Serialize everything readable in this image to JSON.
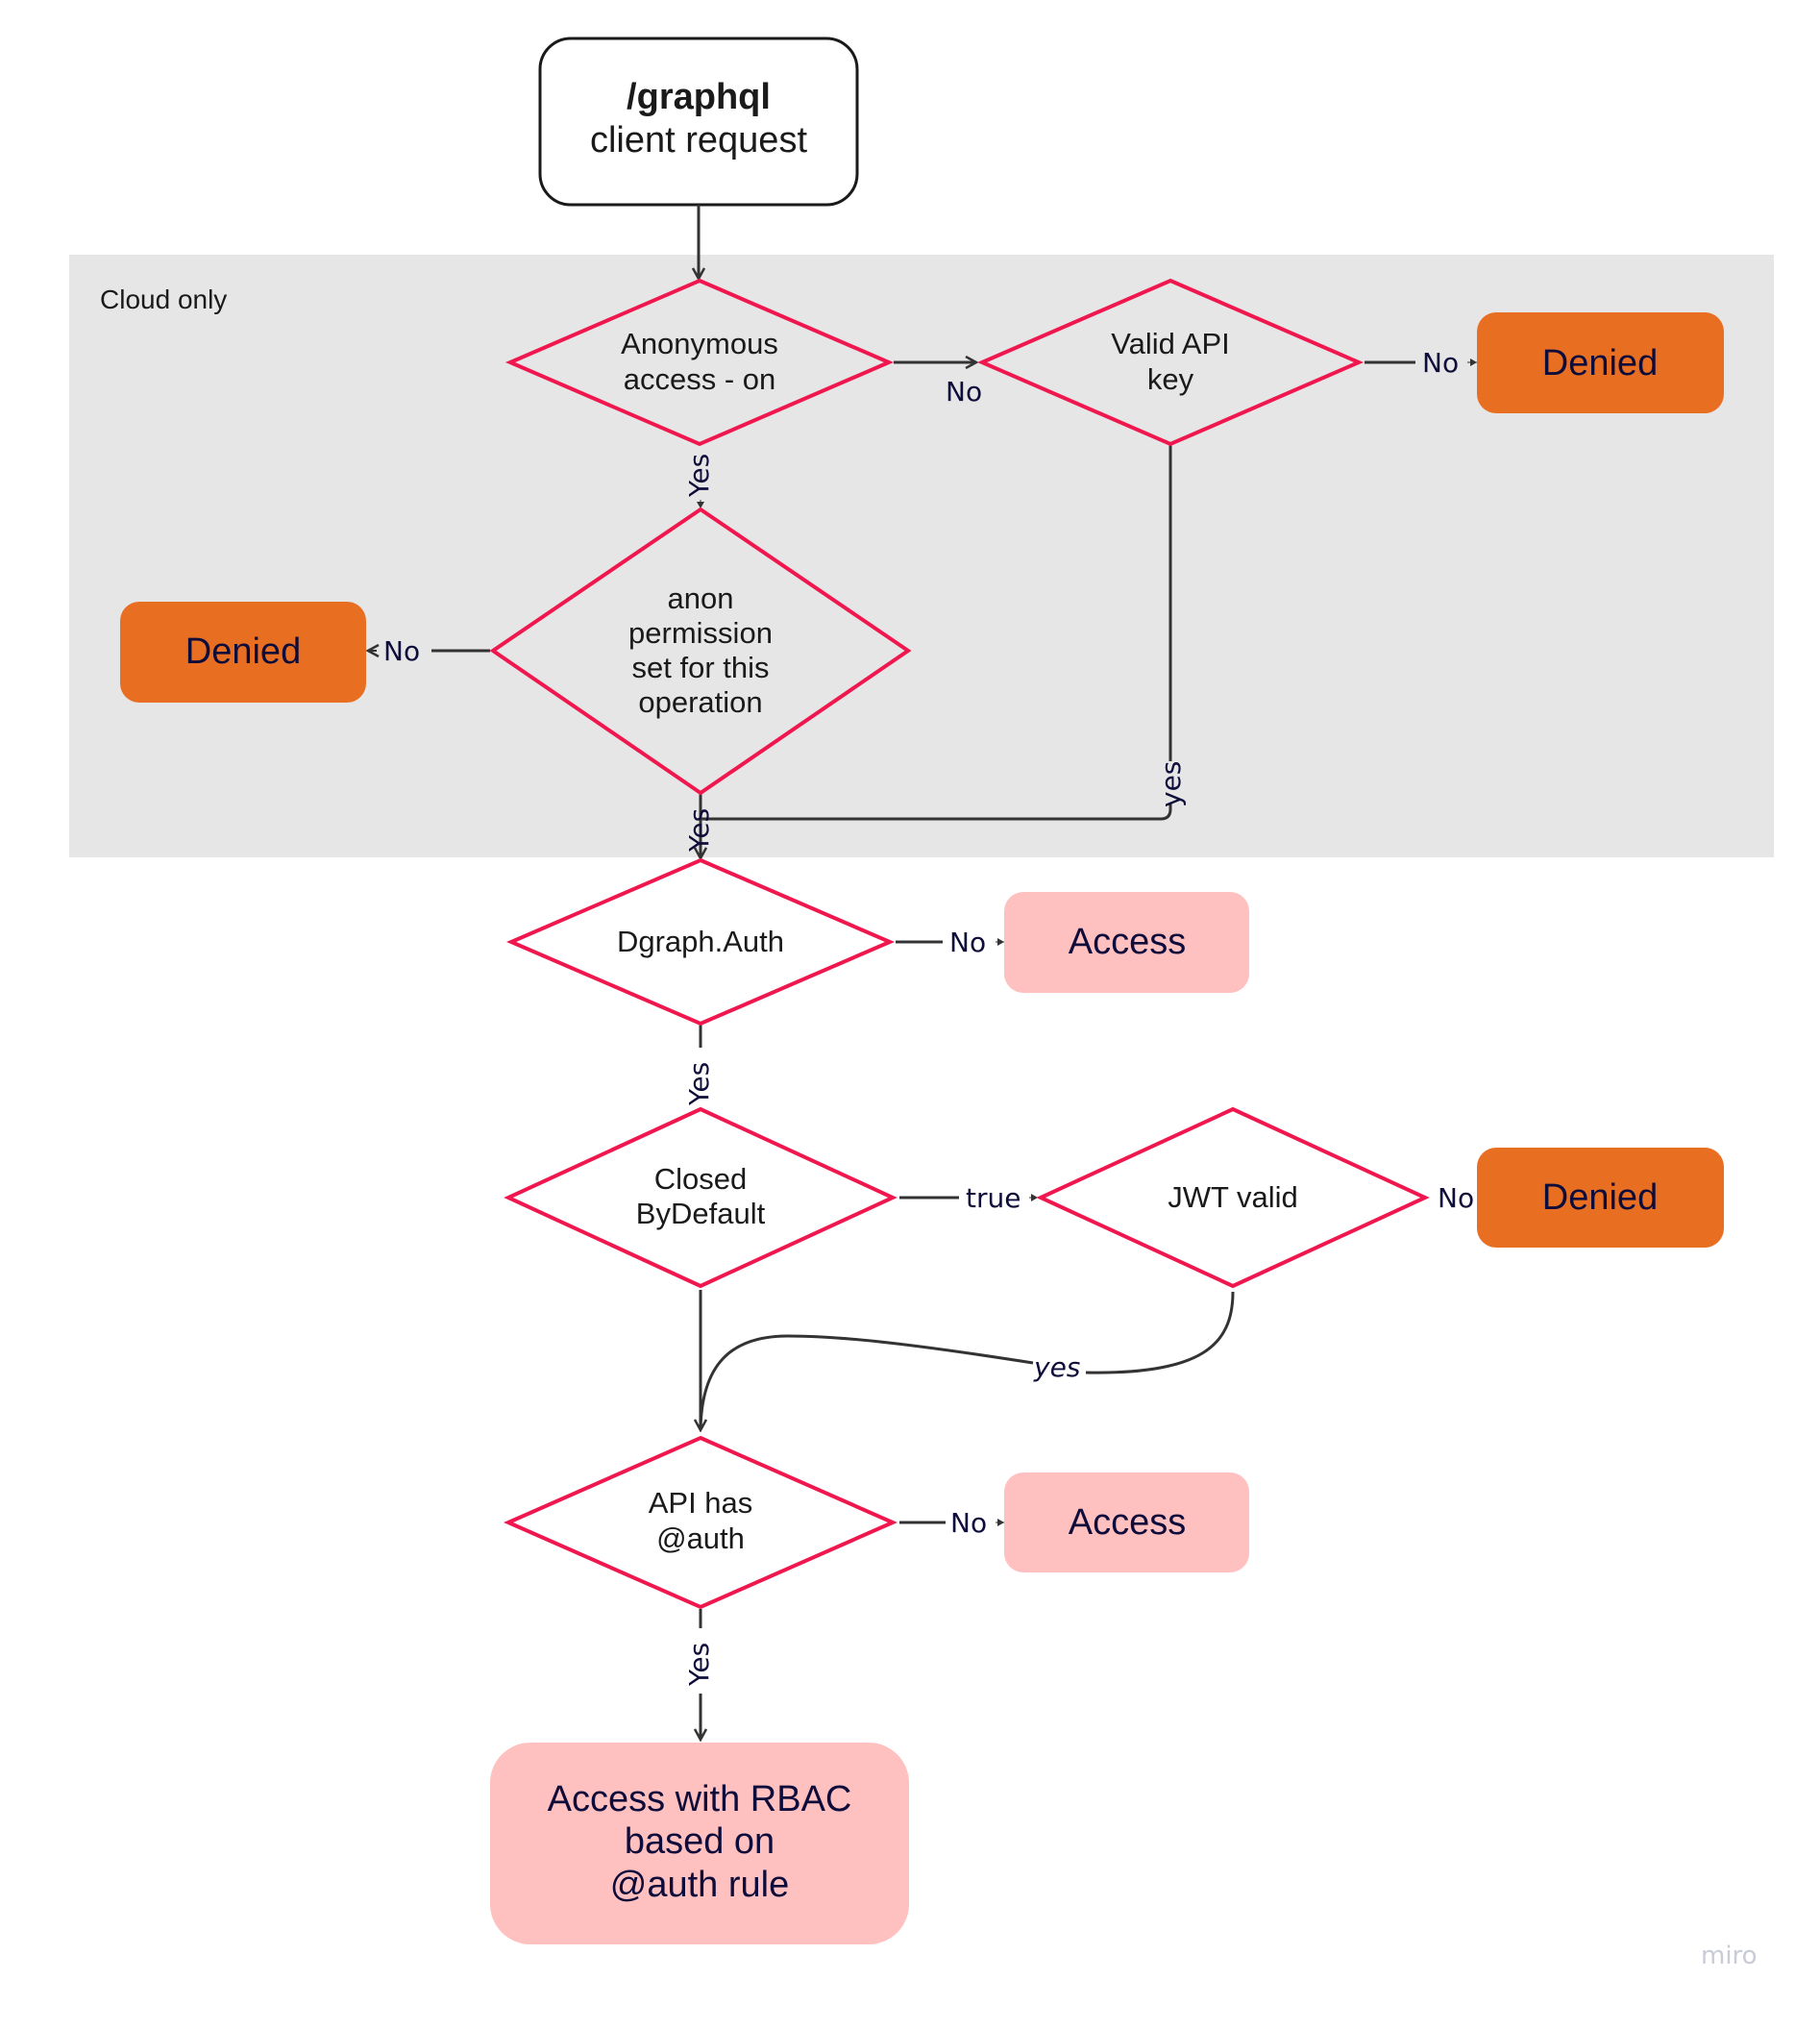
{
  "colors": {
    "panel": "#e6e6e6",
    "decision_stroke": "#f0174e",
    "denied_fill": "#e86f22",
    "access_fill": "#ffc0c0",
    "edge": "#333333",
    "label": "#0d0c3a"
  },
  "start": {
    "title": "/graphql",
    "subtitle": "client request"
  },
  "panel": {
    "label": "Cloud only"
  },
  "decisions": {
    "anonymous": [
      "Anonymous",
      "access - on"
    ],
    "api_key": [
      "Valid API",
      "key"
    ],
    "anon_permission": [
      "anon",
      "permission",
      "set for this",
      "operation"
    ],
    "dgraph_auth": [
      "Dgraph.Auth"
    ],
    "closed_by_default": [
      "Closed",
      "ByDefault"
    ],
    "jwt_valid": [
      "JWT valid"
    ],
    "api_has_auth": [
      "API has",
      "@auth"
    ]
  },
  "outcomes": {
    "denied_api_key": "Denied",
    "denied_anon": "Denied",
    "denied_jwt": "Denied",
    "access_no_auth": "Access",
    "access_no_directive": "Access",
    "rbac": [
      "Access with RBAC",
      "based on",
      "@auth rule"
    ]
  },
  "edge_labels": {
    "anonymous_no": "No",
    "anonymous_yes": "Yes",
    "api_key_no": "No",
    "api_key_yes": "yes",
    "anon_perm_no": "No",
    "anon_perm_yes": "Yes",
    "dgraph_auth_no": "No",
    "dgraph_auth_yes": "Yes",
    "closed_true": "true",
    "jwt_no": "No",
    "jwt_yes": "yes",
    "api_auth_no": "No",
    "api_auth_yes": "Yes"
  },
  "watermark": "miro"
}
